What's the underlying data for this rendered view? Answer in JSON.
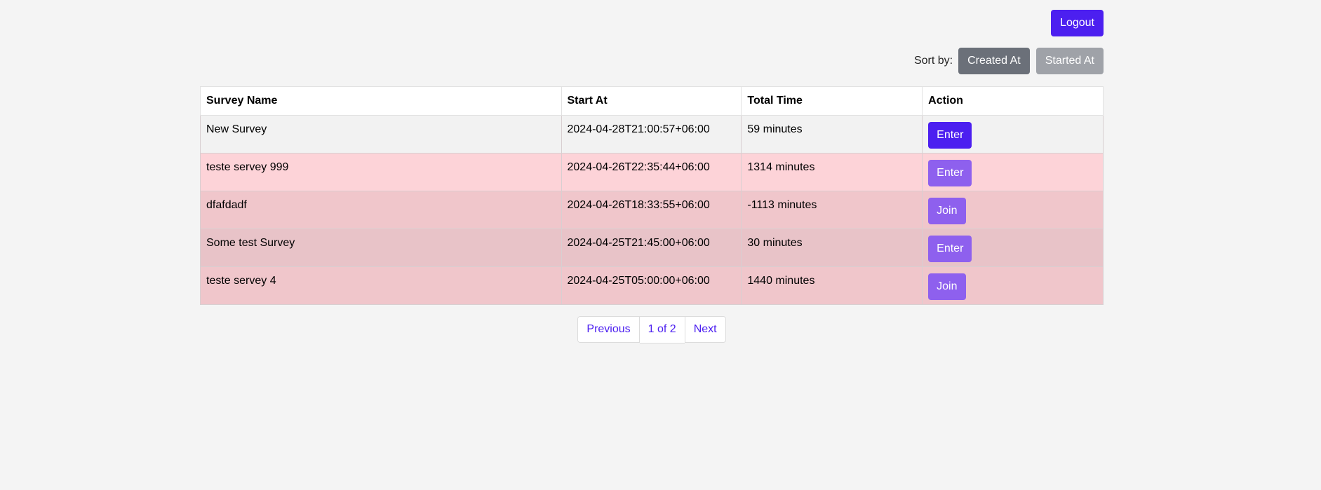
{
  "header": {
    "logout_label": "Logout"
  },
  "sort": {
    "label": "Sort by:",
    "options": [
      {
        "label": "Created At",
        "active": true
      },
      {
        "label": "Started At",
        "active": false
      }
    ]
  },
  "table": {
    "columns": [
      "Survey Name",
      "Start At",
      "Total Time",
      "Action"
    ],
    "rows": [
      {
        "name": "New Survey",
        "start_at": "2024-04-28T21:00:57+06:00",
        "total_time": "59 minutes",
        "action": "Enter",
        "row_color": "#f2f2f2",
        "button_color": "#4c1ff0"
      },
      {
        "name": "teste servey 999",
        "start_at": "2024-04-26T22:35:44+06:00",
        "total_time": "1314 minutes",
        "action": "Enter",
        "row_color": "#fdd3d8",
        "button_color": "#8e60ee"
      },
      {
        "name": "dfafdadf",
        "start_at": "2024-04-26T18:33:55+06:00",
        "total_time": "-1113 minutes",
        "action": "Join",
        "row_color": "#f0c6cb",
        "button_color": "#8e60ee"
      },
      {
        "name": "Some test Survey",
        "start_at": "2024-04-25T21:45:00+06:00",
        "total_time": "30 minutes",
        "action": "Enter",
        "row_color": "#e8c3c8",
        "button_color": "#8e60ee"
      },
      {
        "name": "teste servey 4",
        "start_at": "2024-04-25T05:00:00+06:00",
        "total_time": "1440 minutes",
        "action": "Join",
        "row_color": "#f0c6cb",
        "button_color": "#8e60ee"
      }
    ]
  },
  "pagination": {
    "previous_label": "Previous",
    "current_label": "1 of 2",
    "next_label": "Next"
  },
  "colors": {
    "primary": "#4c1ff0",
    "secondary": "#8e60ee",
    "background": "#f4f4f4"
  }
}
